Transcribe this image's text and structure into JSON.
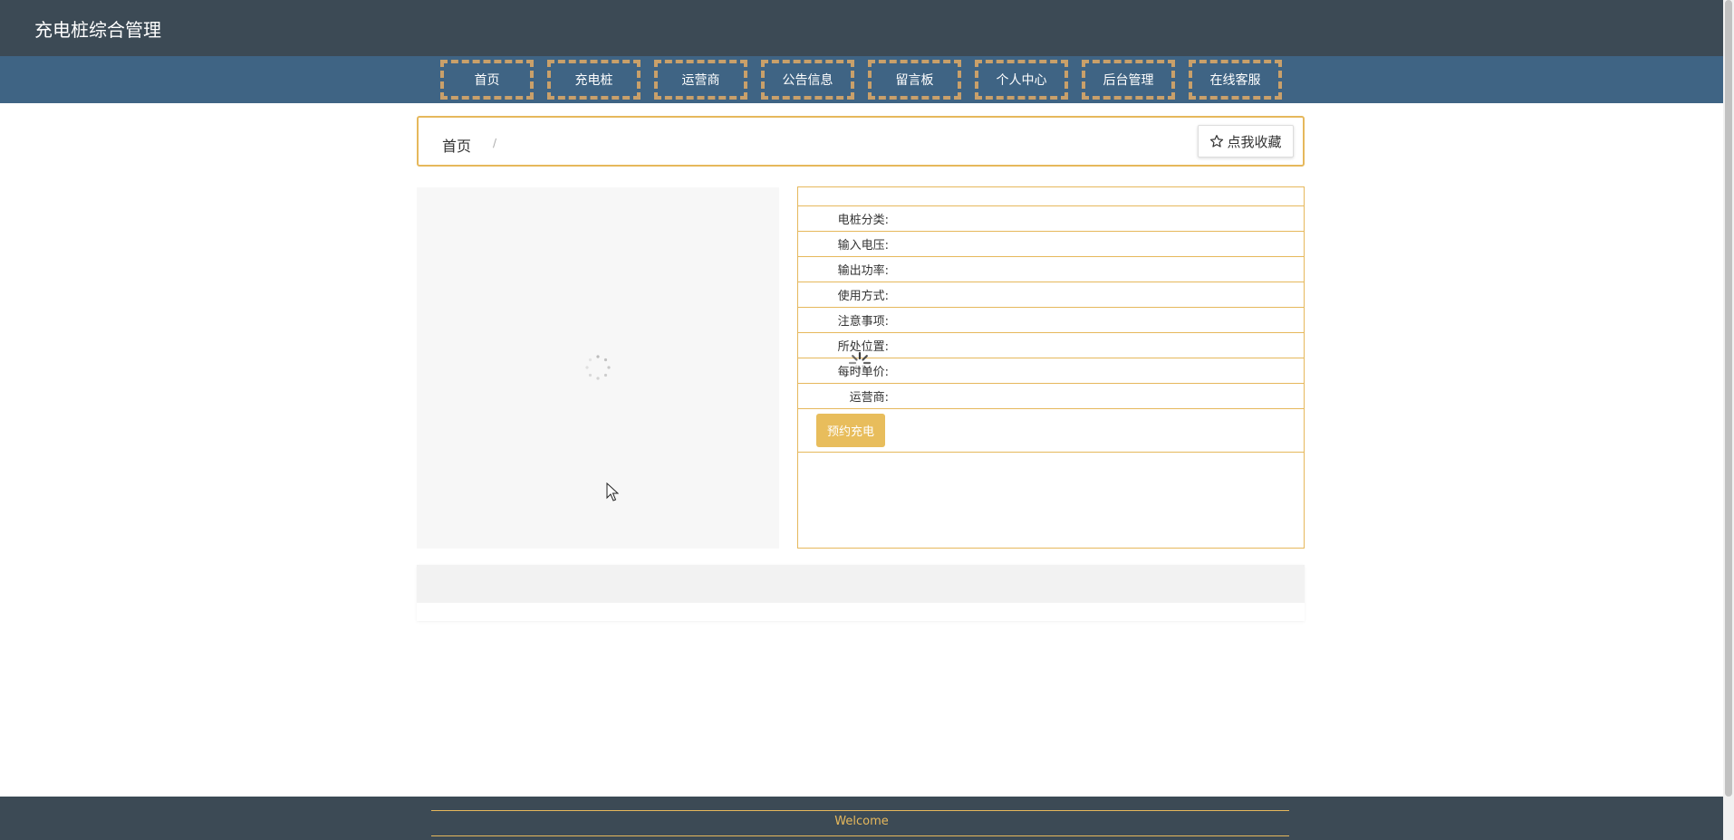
{
  "header": {
    "brand": "充电桩综合管理"
  },
  "nav": {
    "items": [
      {
        "label": "首页"
      },
      {
        "label": "充电桩"
      },
      {
        "label": "运营商"
      },
      {
        "label": "公告信息"
      },
      {
        "label": "留言板"
      },
      {
        "label": "个人中心"
      },
      {
        "label": "后台管理"
      },
      {
        "label": "在线客服"
      }
    ]
  },
  "breadcrumb": {
    "home": "首页",
    "separator": "/",
    "favorite_label": "点我收藏",
    "favorite_icon": "star-outline-icon"
  },
  "details": {
    "title": "",
    "fields": [
      {
        "label": "电桩分类:",
        "value": ""
      },
      {
        "label": "输入电压:",
        "value": ""
      },
      {
        "label": "输出功率:",
        "value": ""
      },
      {
        "label": "使用方式:",
        "value": ""
      },
      {
        "label": "注意事项:",
        "value": ""
      },
      {
        "label": "所处位置:",
        "value": ""
      },
      {
        "label": "每时单价:",
        "value": ""
      },
      {
        "label": "运营商:",
        "value": ""
      }
    ],
    "action_label": "预约充电"
  },
  "footer": {
    "text": "Welcome"
  },
  "colors": {
    "topbar": "#3c4a55",
    "navbar": "#3f6484",
    "accent": "#e6b85c",
    "nav_border": "#c9a06a",
    "button": "#e8bd5c"
  }
}
